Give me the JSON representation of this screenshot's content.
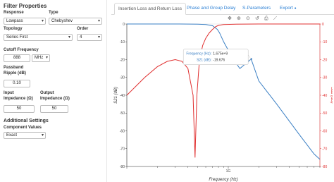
{
  "sidebar": {
    "title": "Filter Properties",
    "response_label": "Response",
    "response_value": "Lowpass",
    "type_label": "Type",
    "type_value": "Chebyshev",
    "topology_label": "Topology",
    "topology_value": "Series First",
    "order_label": "Order",
    "order_value": "4",
    "cutoff_label": "Cutoff Frequency",
    "cutoff_value": "888",
    "cutoff_unit": "MHz",
    "ripple_label_1": "Passband",
    "ripple_label_2": "Ripple (dB)",
    "ripple_value": "0.10",
    "zin_label_1": "Input",
    "zin_label_2": "Impedance (Ω)",
    "zin_value": "50",
    "zout_label_1": "Output",
    "zout_label_2": "Impedance (Ω)",
    "zout_value": "50",
    "additional_title": "Additional Settings",
    "component_label": "Component Values",
    "component_value": "Exact"
  },
  "tabs": {
    "t1": "Insertion Loss and Return Loss",
    "t2": "Phase and Group Delay",
    "t3": "S-Parameters",
    "t4": "Export",
    "t4_icon": "●"
  },
  "toolbar": {
    "pan": "✥",
    "zoom": "⊕",
    "wheel": "⊙",
    "reset": "↺",
    "save": "⎙",
    "hover": "⟋"
  },
  "chart_data": {
    "type": "line",
    "xlabel": "Frequency (Hz)",
    "ylabel_left": "S21 (dB)",
    "ylabel_right": "S11 (dB)",
    "x_scale": "log",
    "x_tick_label": "1G",
    "y_ticks": [
      "0",
      "-10",
      "-20",
      "-30",
      "-40",
      "-50",
      "-60",
      "-70",
      "-80"
    ],
    "ylim": [
      -80,
      0
    ],
    "grid": false,
    "series": [
      {
        "name": "S21 (dB)",
        "color": "#3a7fc4",
        "points": [
          [
            100000000.0,
            0
          ],
          [
            300000000.0,
            0
          ],
          [
            500000000.0,
            -0.1
          ],
          [
            600000000.0,
            -0.3
          ],
          [
            700000000.0,
            -1
          ],
          [
            780000000.0,
            -3
          ],
          [
            820000000.0,
            -5
          ],
          [
            900000000.0,
            -10
          ],
          [
            1100000000.0,
            -19
          ],
          [
            1300000000.0,
            -25
          ],
          [
            1680000000.0,
            -19.676
          ],
          [
            2000000000.0,
            -32
          ],
          [
            3000000000.0,
            -45
          ],
          [
            5000000000.0,
            -62
          ],
          [
            7000000000.0,
            -73
          ],
          [
            8000000000.0,
            -76
          ]
        ]
      },
      {
        "name": "S11 (dB)",
        "color": "#e03030",
        "points": [
          [
            100000000.0,
            -40
          ],
          [
            150000000.0,
            -30
          ],
          [
            200000000.0,
            -24
          ],
          [
            250000000.0,
            -21
          ],
          [
            300000000.0,
            -20
          ],
          [
            350000000.0,
            -21
          ],
          [
            400000000.0,
            -25
          ],
          [
            450000000.0,
            -40
          ],
          [
            470000000.0,
            -75
          ],
          [
            490000000.0,
            -40
          ],
          [
            520000000.0,
            -20
          ],
          [
            560000000.0,
            -12
          ],
          [
            600000000.0,
            -8
          ],
          [
            650000000.0,
            -5
          ],
          [
            700000000.0,
            -3
          ],
          [
            750000000.0,
            -1.5
          ],
          [
            800000000.0,
            -0.8
          ],
          [
            900000000.0,
            -0.3
          ],
          [
            1200000000.0,
            -0.1
          ],
          [
            2000000000.0,
            0
          ],
          [
            8000000000.0,
            0
          ]
        ]
      }
    ]
  },
  "tooltip": {
    "label1": "Frequency (Hz):",
    "value1": "1.675e+9",
    "label2": "S21 (dB):",
    "value2": "-19.676"
  }
}
